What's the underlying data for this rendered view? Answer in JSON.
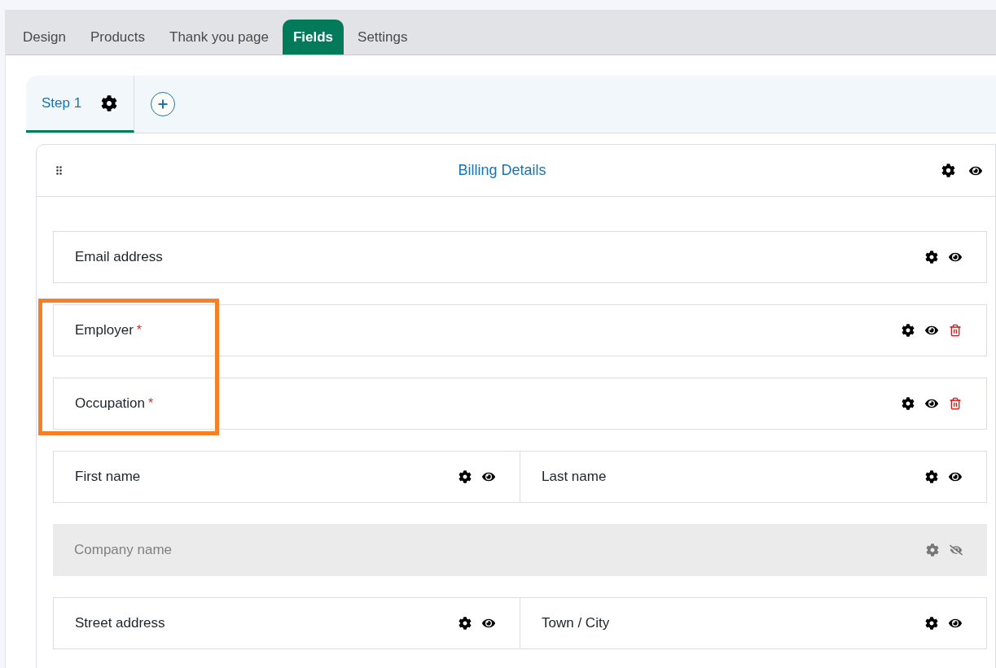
{
  "tabs": [
    {
      "label": "Design",
      "selected": false
    },
    {
      "label": "Products",
      "selected": false
    },
    {
      "label": "Thank you page",
      "selected": false
    },
    {
      "label": "Fields",
      "selected": true
    },
    {
      "label": "Settings",
      "selected": false
    }
  ],
  "steps": [
    {
      "label": "Step 1",
      "selected": true
    }
  ],
  "section": {
    "title": "Billing Details",
    "hidden": false
  },
  "rows": [
    {
      "highlighted": false,
      "fields": [
        {
          "label": "Email address",
          "hidden": false,
          "deletable": false
        }
      ]
    },
    {
      "highlighted": true,
      "fields": [
        {
          "label": "Employer",
          "required_mark": "*",
          "hidden": false,
          "deletable": true
        }
      ]
    },
    {
      "highlighted": true,
      "fields": [
        {
          "label": "Occupation",
          "required_mark": "*",
          "hidden": false,
          "deletable": true
        }
      ]
    },
    {
      "highlighted": false,
      "fields": [
        {
          "label": "First name",
          "hidden": false,
          "deletable": false
        },
        {
          "label": "Last name",
          "hidden": false,
          "deletable": false
        }
      ]
    },
    {
      "highlighted": false,
      "fields": [
        {
          "label": "Company name",
          "hidden": true,
          "deletable": false
        }
      ]
    },
    {
      "highlighted": false,
      "fields": [
        {
          "label": "Street address",
          "hidden": false,
          "deletable": false
        },
        {
          "label": "Town / City",
          "hidden": false,
          "deletable": false
        }
      ]
    }
  ]
}
